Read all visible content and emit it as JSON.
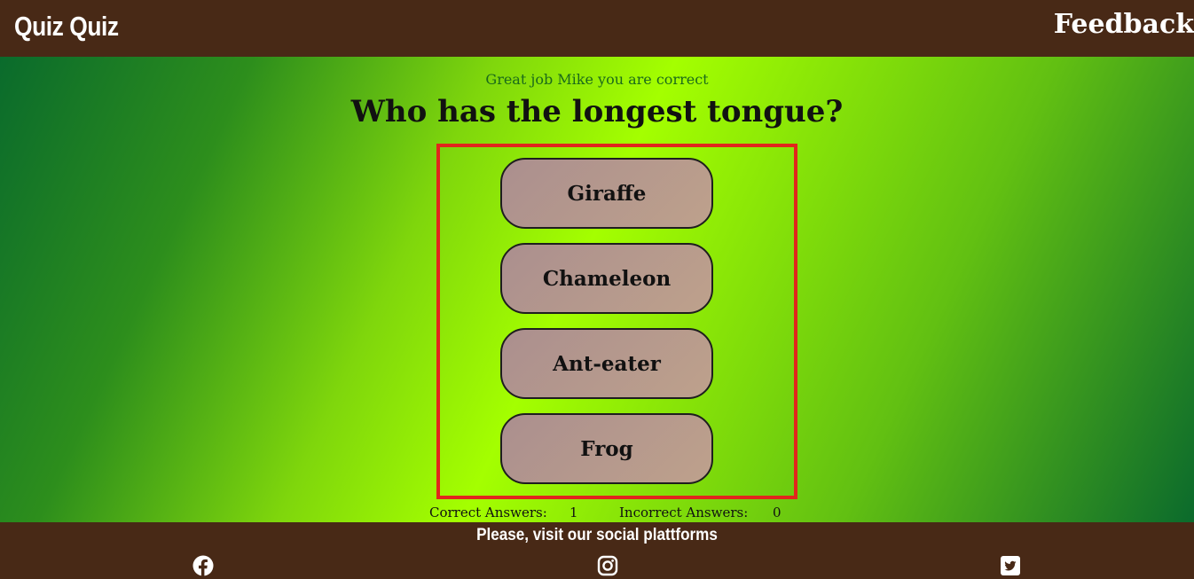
{
  "header": {
    "logo": "Quiz Quiz",
    "nav_feedback": "Feedback"
  },
  "quiz": {
    "feedback_message": "Great job Mike you are correct",
    "question": "Who has the longest tongue?",
    "answers": [
      "Giraffe",
      "Chameleon",
      "Ant-eater",
      "Frog"
    ],
    "score": {
      "correct_label": "Correct Answers:",
      "correct_value": "1",
      "incorrect_label": "Incorrect Answers:",
      "incorrect_value": "0"
    }
  },
  "footer": {
    "text": "Please, visit our social plattforms",
    "icons": [
      "facebook-icon",
      "instagram-icon",
      "twitter-icon"
    ]
  },
  "colors": {
    "header_bg": "#482916",
    "answers_border": "#e1261c",
    "gradient_light": "#a4ff00",
    "gradient_dark": "#0a6b2c"
  }
}
